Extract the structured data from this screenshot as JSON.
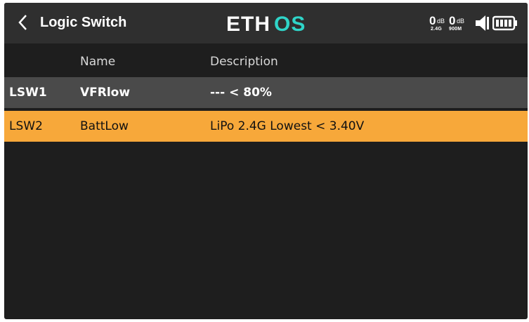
{
  "topbar": {
    "title": "Logic Switch",
    "logo_text": "ETHOS",
    "back_icon": "chevron-left-icon",
    "signal_1_value": "0",
    "signal_1_unit": "dB",
    "signal_2_value": "0",
    "signal_2_unit": "dB",
    "signal_1_band": "2.4G",
    "signal_2_band": "900M",
    "volume_icon": "speaker-icon",
    "battery_icon": "battery-icon"
  },
  "table": {
    "columns": [
      "",
      "Name",
      "Description"
    ],
    "rows": [
      {
        "id": "LSW1",
        "name": "VFRlow",
        "description": "--- < 80%"
      },
      {
        "id": "LSW2",
        "name": "BattLow",
        "description": "LiPo 2.4G Lowest < 3.40V"
      }
    ],
    "selected_row": 1
  },
  "colors": {
    "background": "#1e1e1e",
    "topbar": "#2f2f2f",
    "row_dark": "#4a4a4a",
    "row_selected": "#f7a83a",
    "logo_accent": "#2fd4c8"
  }
}
